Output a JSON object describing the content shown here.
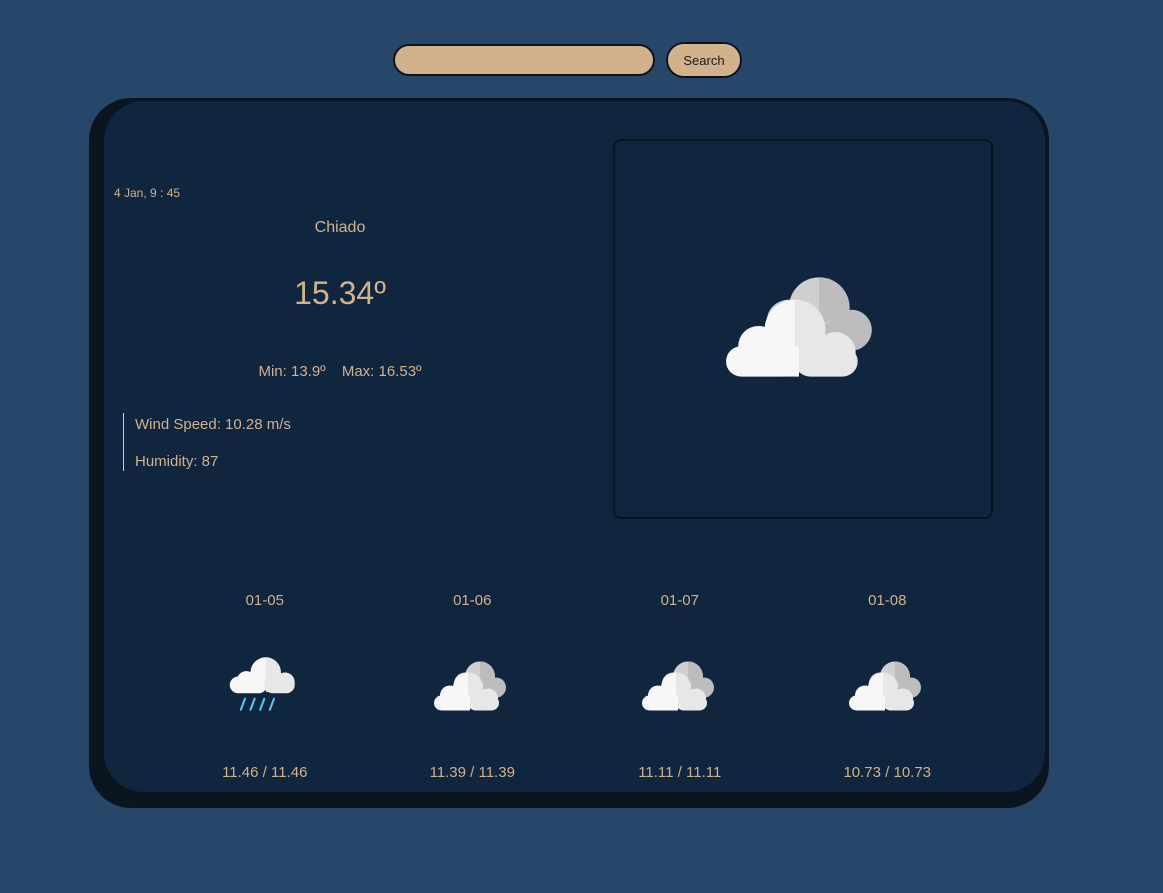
{
  "search": {
    "value": "",
    "placeholder": "",
    "button_label": "Search"
  },
  "current": {
    "datetime": "4 Jan, 9 : 45",
    "city": "Chiado",
    "temperature": "15.34º",
    "min": "Min: 13.9º",
    "max": "Max: 16.53º",
    "wind": "Wind Speed: 10.28 m/s",
    "humidity": "Humidity: 87",
    "icon": "partly-cloudy-icon"
  },
  "forecast": [
    {
      "date": "01-05",
      "temps": "11.46 / 11.46",
      "icon": "rain-cloud-icon"
    },
    {
      "date": "01-06",
      "temps": "11.39 / 11.39",
      "icon": "partly-cloudy-icon"
    },
    {
      "date": "01-07",
      "temps": "11.11 / 11.11",
      "icon": "partly-cloudy-icon"
    },
    {
      "date": "01-08",
      "temps": "10.73 / 10.73",
      "icon": "partly-cloudy-icon"
    }
  ],
  "colors": {
    "background": "#26476a",
    "card": "#10263f",
    "accent_text": "#d1b28c",
    "input_fill": "#d1b28c",
    "divider": "#d6d67a",
    "rain": "#5fc0ec"
  }
}
